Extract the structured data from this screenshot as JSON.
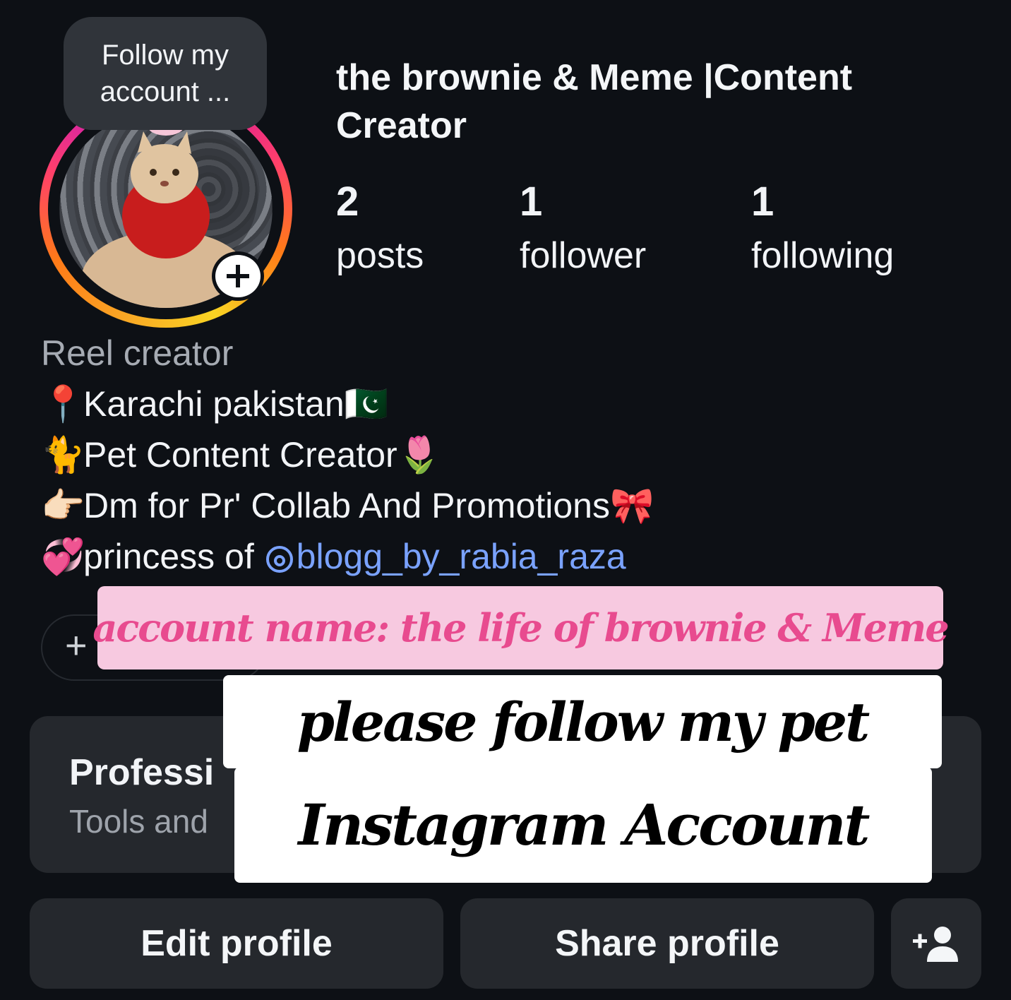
{
  "tooltip": {
    "line1": "Follow my",
    "line2": "account ..."
  },
  "profile": {
    "display_name_line1": "the brownie & Meme |Content",
    "display_name_line2": "Creator",
    "avatar_icon": "cat-photo-avatar",
    "add_story_icon": "plus-icon"
  },
  "stats": [
    {
      "value": "2",
      "label": "posts"
    },
    {
      "value": "1",
      "label": "follower"
    },
    {
      "value": "1",
      "label": "following"
    }
  ],
  "bio": {
    "category": "Reel creator",
    "lines": [
      {
        "emoji": "📍",
        "text": "Karachi pakistan",
        "suffix_emoji": "🇵🇰"
      },
      {
        "emoji": "🐈",
        "text": "Pet Content Creator",
        "suffix_emoji": "🌷"
      },
      {
        "emoji": "👉🏻",
        "text": "Dm for Pr' Collab And Promotions",
        "suffix_emoji": "🎀"
      },
      {
        "emoji": "💞",
        "text": "princess of ",
        "mention": "blogg_by_rabia_raza"
      }
    ]
  },
  "highlights": {
    "new_label": "+"
  },
  "overlay": {
    "account_name": "account name: the life of brownie & Meme",
    "cta_line1": "please follow my pet",
    "cta_line2": "Instagram Account"
  },
  "professional": {
    "title": "Professi",
    "subtitle": "Tools and"
  },
  "actions": {
    "edit_label": "Edit profile",
    "share_label": "Share profile",
    "discover_icon": "add-person-icon"
  },
  "colors": {
    "background": "#0d1015",
    "card": "#25282d",
    "mention": "#7aa2ff",
    "banner_pink": "#f7c9e0",
    "banner_text": "#e84b8f"
  }
}
